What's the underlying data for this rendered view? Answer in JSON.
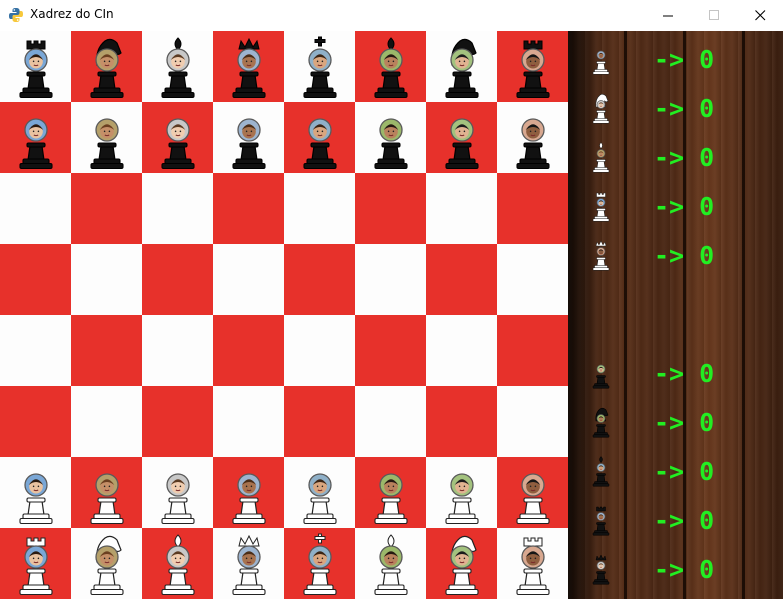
{
  "window": {
    "title": "Xadrez do CIn",
    "minimize_label": "—",
    "maximize_label": "☐",
    "close_label": "✕",
    "icon": "python-snake-icon"
  },
  "board": {
    "light_color": "#fdfdfd",
    "dark_color": "#e7312b",
    "rows": [
      [
        {
          "type": "rook",
          "color": "black"
        },
        {
          "type": "knight",
          "color": "black"
        },
        {
          "type": "bishop",
          "color": "black"
        },
        {
          "type": "queen",
          "color": "black"
        },
        {
          "type": "king",
          "color": "black"
        },
        {
          "type": "bishop",
          "color": "black"
        },
        {
          "type": "knight",
          "color": "black"
        },
        {
          "type": "rook",
          "color": "black"
        }
      ],
      [
        {
          "type": "pawn",
          "color": "black"
        },
        {
          "type": "pawn",
          "color": "black"
        },
        {
          "type": "pawn",
          "color": "black"
        },
        {
          "type": "pawn",
          "color": "black"
        },
        {
          "type": "pawn",
          "color": "black"
        },
        {
          "type": "pawn",
          "color": "black"
        },
        {
          "type": "pawn",
          "color": "black"
        },
        {
          "type": "pawn",
          "color": "black"
        }
      ],
      [
        null,
        null,
        null,
        null,
        null,
        null,
        null,
        null
      ],
      [
        null,
        null,
        null,
        null,
        null,
        null,
        null,
        null
      ],
      [
        null,
        null,
        null,
        null,
        null,
        null,
        null,
        null
      ],
      [
        null,
        null,
        null,
        null,
        null,
        null,
        null,
        null
      ],
      [
        {
          "type": "pawn",
          "color": "white"
        },
        {
          "type": "pawn",
          "color": "white"
        },
        {
          "type": "pawn",
          "color": "white"
        },
        {
          "type": "pawn",
          "color": "white"
        },
        {
          "type": "pawn",
          "color": "white"
        },
        {
          "type": "pawn",
          "color": "white"
        },
        {
          "type": "pawn",
          "color": "white"
        },
        {
          "type": "pawn",
          "color": "white"
        }
      ],
      [
        {
          "type": "rook",
          "color": "white"
        },
        {
          "type": "knight",
          "color": "white"
        },
        {
          "type": "bishop",
          "color": "white"
        },
        {
          "type": "queen",
          "color": "white"
        },
        {
          "type": "king",
          "color": "white"
        },
        {
          "type": "bishop",
          "color": "white"
        },
        {
          "type": "knight",
          "color": "white"
        },
        {
          "type": "rook",
          "color": "white"
        }
      ]
    ]
  },
  "captured": {
    "counter_color": "#22ee22",
    "top": [
      {
        "piece": "pawn",
        "color": "white",
        "label": "-> 0"
      },
      {
        "piece": "knight",
        "color": "white",
        "label": "-> 0"
      },
      {
        "piece": "bishop",
        "color": "white",
        "label": "-> 0"
      },
      {
        "piece": "rook",
        "color": "white",
        "label": "-> 0"
      },
      {
        "piece": "queen",
        "color": "white",
        "label": "-> 0"
      }
    ],
    "bottom": [
      {
        "piece": "pawn",
        "color": "black",
        "label": "-> 0"
      },
      {
        "piece": "knight",
        "color": "black",
        "label": "-> 0"
      },
      {
        "piece": "bishop",
        "color": "black",
        "label": "-> 0"
      },
      {
        "piece": "rook",
        "color": "black",
        "label": "-> 0"
      },
      {
        "piece": "queen",
        "color": "black",
        "label": "-> 0"
      }
    ]
  }
}
